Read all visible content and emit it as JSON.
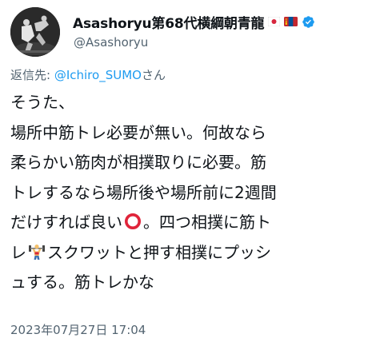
{
  "author": {
    "display_name": "Asashoryu第68代横綱朝青龍",
    "handle": "@Asashoryu",
    "flags": [
      "japan-flag-icon",
      "mongolia-flag-icon"
    ],
    "verified": true
  },
  "reply": {
    "prefix": "返信先: ",
    "mention": "@Ichiro_SUMO",
    "suffix": "さん"
  },
  "tweet": {
    "lines": [
      {
        "text": "そうた、"
      },
      {
        "text": "場所中筋トレ必要が無い。何故なら"
      },
      {
        "text": "柔らかい筋肉が相撲取りに必要。筋"
      },
      {
        "text": "トレするなら場所後や場所前に2週間"
      },
      {
        "before": "だけすれば良い",
        "emoji": "heavy-circle-icon",
        "after": "。四つ相撲に筋ト"
      },
      {
        "before": "レ",
        "emoji": "weightlifter-icon",
        "after": "スクワットと押す相撲にプッシ"
      },
      {
        "text": "ュする。筋トレかな"
      }
    ]
  },
  "timestamp": "2023年07月27日 17:04",
  "colors": {
    "text": "#0f1419",
    "secondary": "#536471",
    "link": "#1d9bf0",
    "verified": "#1d9bf0",
    "circle_emoji": "#e0243a"
  }
}
